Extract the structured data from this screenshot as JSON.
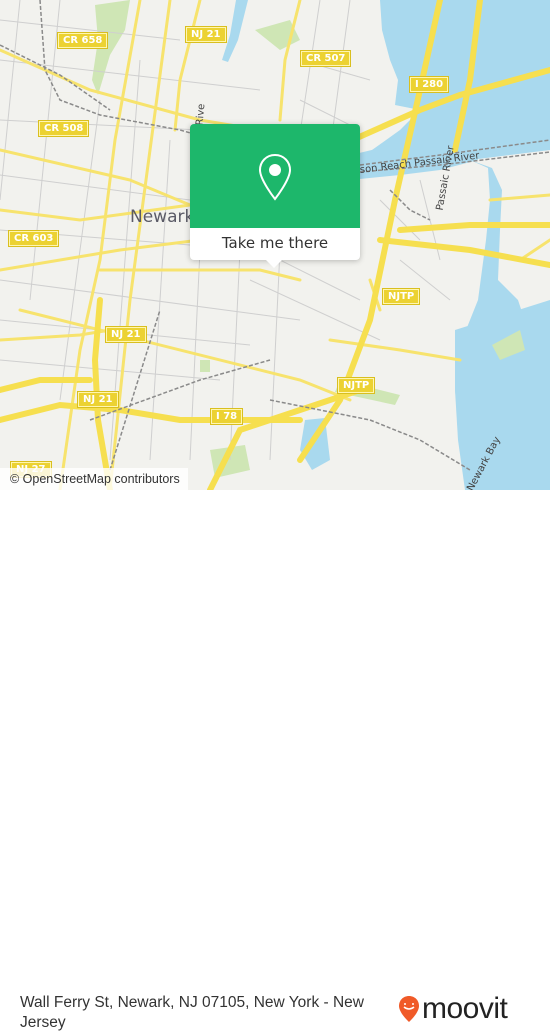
{
  "map": {
    "city_label": "Newark",
    "road_shields": [
      {
        "id": "cr-658",
        "label": "CR 658"
      },
      {
        "id": "nj-21-top",
        "label": "NJ 21"
      },
      {
        "id": "cr-507",
        "label": "CR 507"
      },
      {
        "id": "i-280",
        "label": "I 280"
      },
      {
        "id": "cr-508",
        "label": "CR 508"
      },
      {
        "id": "cr-603",
        "label": "CR 603"
      },
      {
        "id": "njtp-upper",
        "label": "NJTP"
      },
      {
        "id": "nj-21-mid",
        "label": "NJ 21"
      },
      {
        "id": "nj-21-low",
        "label": "NJ 21"
      },
      {
        "id": "i-78",
        "label": "I 78"
      },
      {
        "id": "njtp-lower",
        "label": "NJTP"
      },
      {
        "id": "nj-27",
        "label": "NJ 27"
      }
    ],
    "water_labels": {
      "passaic_reach": "son Reach Passaic River",
      "passaic_river": "Passaic River",
      "river_left": "Rive",
      "newark_bay": "Newark Bay"
    },
    "colors": {
      "land": "#f2f2ee",
      "water": "#a9d9ee",
      "park": "#cfe6b5",
      "road_major": "#f7e36d",
      "road_minor": "#c9c9c9",
      "rail": "#8a8a8a",
      "shield": "#ecd232"
    }
  },
  "attribution": "© OpenStreetMap contributors",
  "popup": {
    "button_label": "Take me there",
    "icon": "map-pin-icon",
    "color": "#1db76b"
  },
  "footer": {
    "address": "Wall Ferry St, Newark, NJ 07105, New York - New Jersey",
    "logo_text": "moovit",
    "logo_color": "#f05a28"
  }
}
